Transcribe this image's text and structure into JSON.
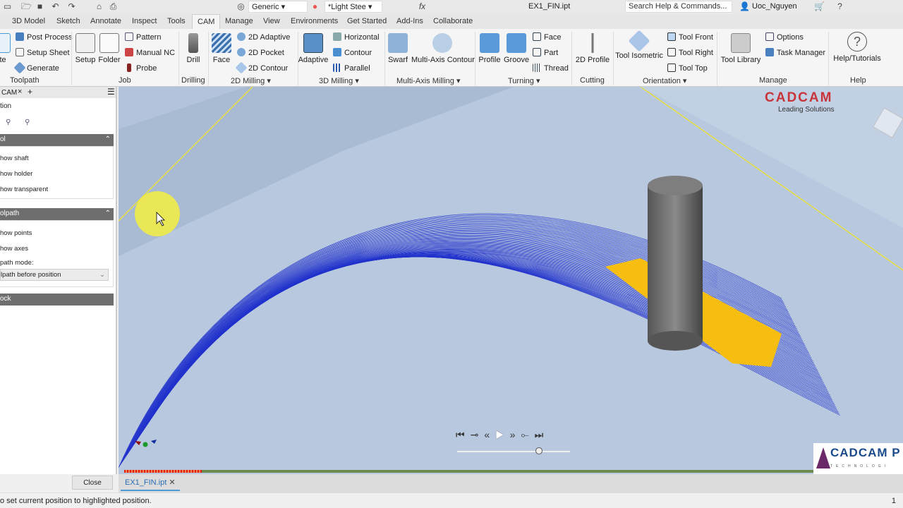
{
  "app": {
    "file_title": "EX1_FIN.ipt",
    "search_placeholder": "Search Help & Commands...",
    "user": "Uoc_Nguyen",
    "appearance": "Generic",
    "material": "*Light Stee"
  },
  "tabs": [
    "3D Model",
    "Sketch",
    "Annotate",
    "Inspect",
    "Tools",
    "CAM",
    "Manage",
    "View",
    "Environments",
    "Get Started",
    "Add-Ins",
    "Collaborate"
  ],
  "ribbon": {
    "toolpath": {
      "items": [
        "Post Process",
        "Setup Sheet",
        "Generate"
      ],
      "partial": "ate",
      "label": "Toolpath"
    },
    "job": {
      "big": [
        "Setup",
        "Folder"
      ],
      "items": [
        "Pattern",
        "Manual NC",
        "Probe"
      ],
      "label": "Job"
    },
    "drilling": {
      "big": [
        "Drill"
      ],
      "label": "Drilling"
    },
    "milling2d": {
      "big": [
        "Face"
      ],
      "items": [
        "2D Adaptive",
        "2D Pocket",
        "2D Contour"
      ],
      "label": "2D Milling"
    },
    "milling3d": {
      "big": [
        "Adaptive"
      ],
      "items": [
        "Horizontal",
        "Contour",
        "Parallel"
      ],
      "label": "3D Milling"
    },
    "multiaxis": {
      "big": [
        "Swarf",
        "Multi-Axis Contour"
      ],
      "label": "Multi-Axis Milling"
    },
    "turning": {
      "big": [
        "Profile",
        "Groove"
      ],
      "items": [
        "Face",
        "Part",
        "Thread"
      ],
      "label": "Turning"
    },
    "cutting": {
      "big": [
        "2D Profile"
      ],
      "label": "Cutting"
    },
    "orientation": {
      "big": [
        "Tool Isometric"
      ],
      "items": [
        "Tool Front",
        "Tool Right",
        "Tool Top"
      ],
      "label": "Orientation"
    },
    "manage": {
      "big": [
        "Tool Library"
      ],
      "items": [
        "Options",
        "Task Manager"
      ],
      "label": "Manage"
    },
    "help": {
      "big": [
        "Help/Tutorials"
      ],
      "label": "Help"
    }
  },
  "panel": {
    "tab": "CAM",
    "title": "tion",
    "tool_section": "ol",
    "tool_options": [
      "how shaft",
      "how holder",
      "how transparent"
    ],
    "toolpath_section": "olpath",
    "toolpath_options": [
      "how points",
      "how axes"
    ],
    "mode_label": "path mode:",
    "mode_value": "lpath before position",
    "stock_section": "ock",
    "close": "Close"
  },
  "viewport": {
    "brand": "CADCAM",
    "brand_sub": "Leading Solutions",
    "logo2": "CADCAM P",
    "logo2_sub": "TECHNOLOGI",
    "playback_progress": 0.74,
    "timeline_progress": 0.1
  },
  "doc_tab": "EX1_FIN.ipt",
  "status": {
    "message": "o set current position to highlighted position.",
    "count": "1"
  }
}
